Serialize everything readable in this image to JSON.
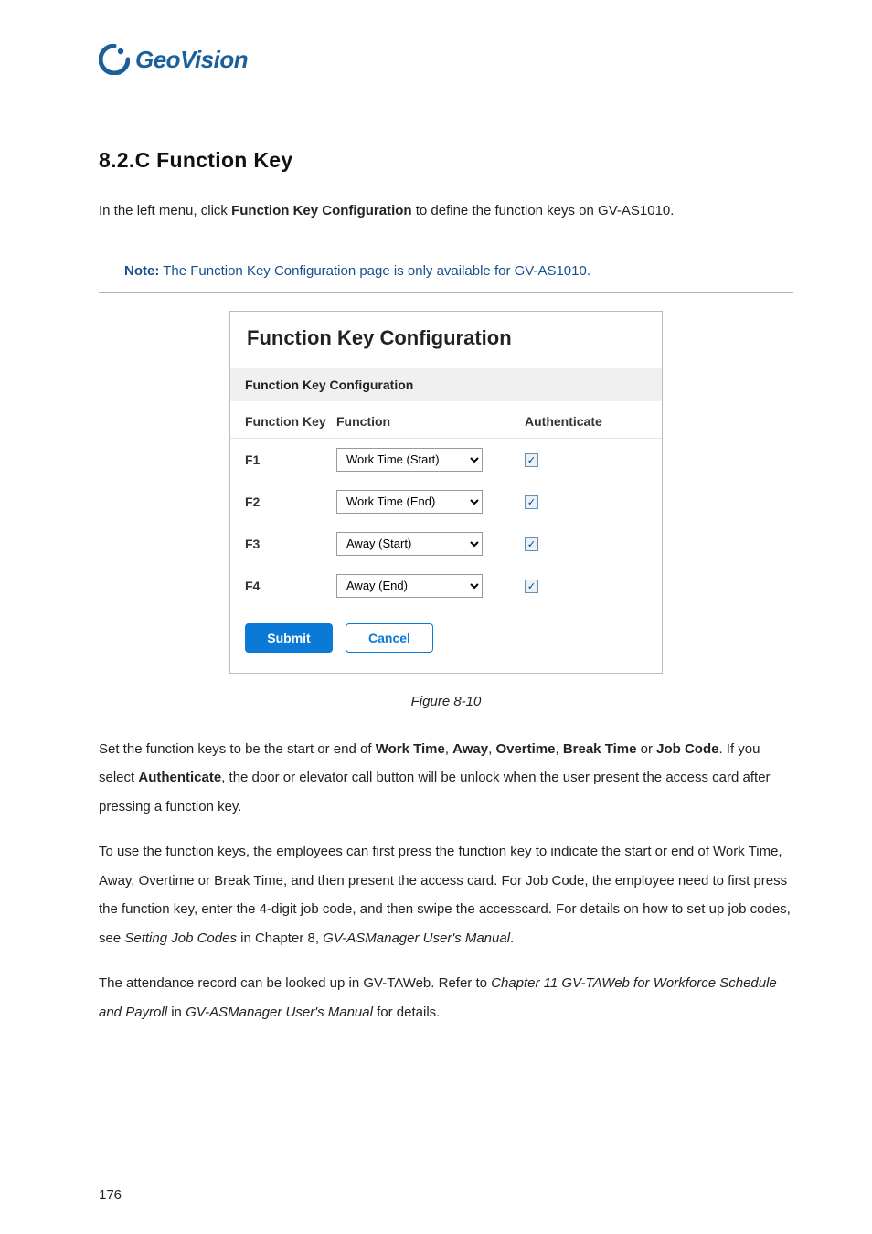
{
  "logo": {
    "text": "GeoVision"
  },
  "section_title": "8.2.C  Function Key",
  "intro": {
    "p1a": "In the left menu, click ",
    "p1b": "Function Key Configuration",
    "p1c": " to define the function keys on GV-AS1010."
  },
  "note": {
    "label": "Note:",
    "text": " The Function Key Configuration page is only available for GV-AS1010."
  },
  "panel": {
    "title": "Function Key Configuration",
    "subtitle": "Function Key Configuration",
    "head": {
      "key": "Function Key",
      "func": "Function",
      "auth": "Authenticate"
    },
    "rows": [
      {
        "key": "F1",
        "func": "Work Time (Start)",
        "checked": true
      },
      {
        "key": "F2",
        "func": "Work Time (End)",
        "checked": true
      },
      {
        "key": "F3",
        "func": "Away (Start)",
        "checked": true
      },
      {
        "key": "F4",
        "func": "Away (End)",
        "checked": true
      }
    ],
    "buttons": {
      "submit": "Submit",
      "cancel": "Cancel"
    }
  },
  "fig_caption": "Figure 8-10",
  "body": {
    "p1": {
      "t1": "Set the function keys to be the start or end of ",
      "b1": "Work Time",
      "c1": ", ",
      "b2": "Away",
      "c2": ", ",
      "b3": "Overtime",
      "c3": ", ",
      "b4": "Break Time",
      "c4": " or ",
      "b5": "Job Code",
      "c5": ". If you select ",
      "b6": "Authenticate",
      "c6": ", the door or elevator call button will be unlock when the user present the access card after pressing a function key."
    },
    "p2": {
      "t1": "To use the function keys, the employees can first press the function key to indicate the start or end of Work Time, Away, Overtime or Break Time, and then present the access card. For Job Code, the employee need to first press the function key, enter the 4-digit job code, and then swipe the accesscard. For details on how to set up job codes, see ",
      "i1": "Setting Job Codes",
      "t2": " in Chapter 8, ",
      "i2": "GV-ASManager User's Manual",
      "t3": "."
    },
    "p3": {
      "t1": "The attendance record can be looked up in GV-TAWeb. Refer to ",
      "i1": "Chapter 11 GV-TAWeb for Workforce Schedule and Payroll",
      "t2": " in ",
      "i2": "GV-ASManager User's Manual",
      "t3": " for details."
    }
  },
  "page_num": "176"
}
